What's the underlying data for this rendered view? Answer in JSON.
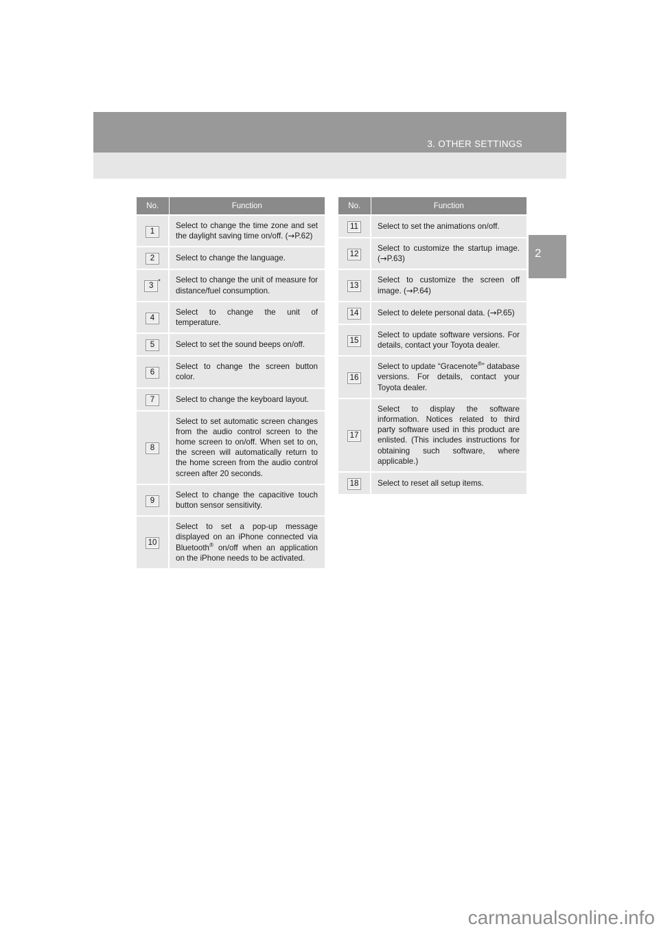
{
  "page": {
    "header_title": "3. OTHER SETTINGS",
    "chapter_tab": "2",
    "watermark": "carmanualsonline.info"
  },
  "tables": {
    "left": {
      "columns": [
        "No.",
        "Function"
      ],
      "rows": [
        {
          "no": "1",
          "star": false,
          "text": "Select to change the time zone and set the daylight saving time on/off. (→P.62)"
        },
        {
          "no": "2",
          "star": false,
          "text": "Select to change the language."
        },
        {
          "no": "3",
          "star": true,
          "text": "Select to change the unit of measure for distance/fuel consumption."
        },
        {
          "no": "4",
          "star": false,
          "text": "Select to change the unit of temperature."
        },
        {
          "no": "5",
          "star": false,
          "text": "Select to set the sound beeps on/off."
        },
        {
          "no": "6",
          "star": false,
          "text": "Select to change the screen button color."
        },
        {
          "no": "7",
          "star": false,
          "text": "Select to change the keyboard layout."
        },
        {
          "no": "8",
          "star": false,
          "text": "Select to set automatic screen changes from the audio control screen to the home screen to on/off. When set to on, the screen will automatically return to the home screen from the audio control screen after 20 seconds."
        },
        {
          "no": "9",
          "star": false,
          "text": "Select to change the capacitive touch button sensor sensitivity."
        },
        {
          "no": "10",
          "star": false,
          "text": "Select to set a pop-up message displayed on an iPhone connected via Bluetooth® on/off when an application on the iPhone needs to be activated."
        }
      ]
    },
    "right": {
      "columns": [
        "No.",
        "Function"
      ],
      "rows": [
        {
          "no": "11",
          "star": false,
          "text": "Select to set the animations on/off."
        },
        {
          "no": "12",
          "star": false,
          "text": "Select to customize the startup image. (→P.63)"
        },
        {
          "no": "13",
          "star": false,
          "text": "Select to customize the screen off image. (→P.64)"
        },
        {
          "no": "14",
          "star": false,
          "text": "Select to delete personal data. (→P.65)"
        },
        {
          "no": "15",
          "star": false,
          "text": "Select to update software versions. For details, contact your Toyota dealer."
        },
        {
          "no": "16",
          "star": false,
          "text": "Select to update “Gracenote®” database versions. For details, contact your Toyota dealer."
        },
        {
          "no": "17",
          "star": false,
          "text": "Select to display the software information. Notices related to third party software used in this product are enlisted. (This includes instructions for obtaining such software, where applicable.)"
        },
        {
          "no": "18",
          "star": false,
          "text": "Select to reset all setup items."
        }
      ]
    }
  },
  "colors": {
    "header_band": "#999999",
    "header_subband": "#e6e6e6",
    "table_header": "#8a8a8a",
    "cell_bg": "#e7e7e7",
    "page_bg": "#000000"
  }
}
